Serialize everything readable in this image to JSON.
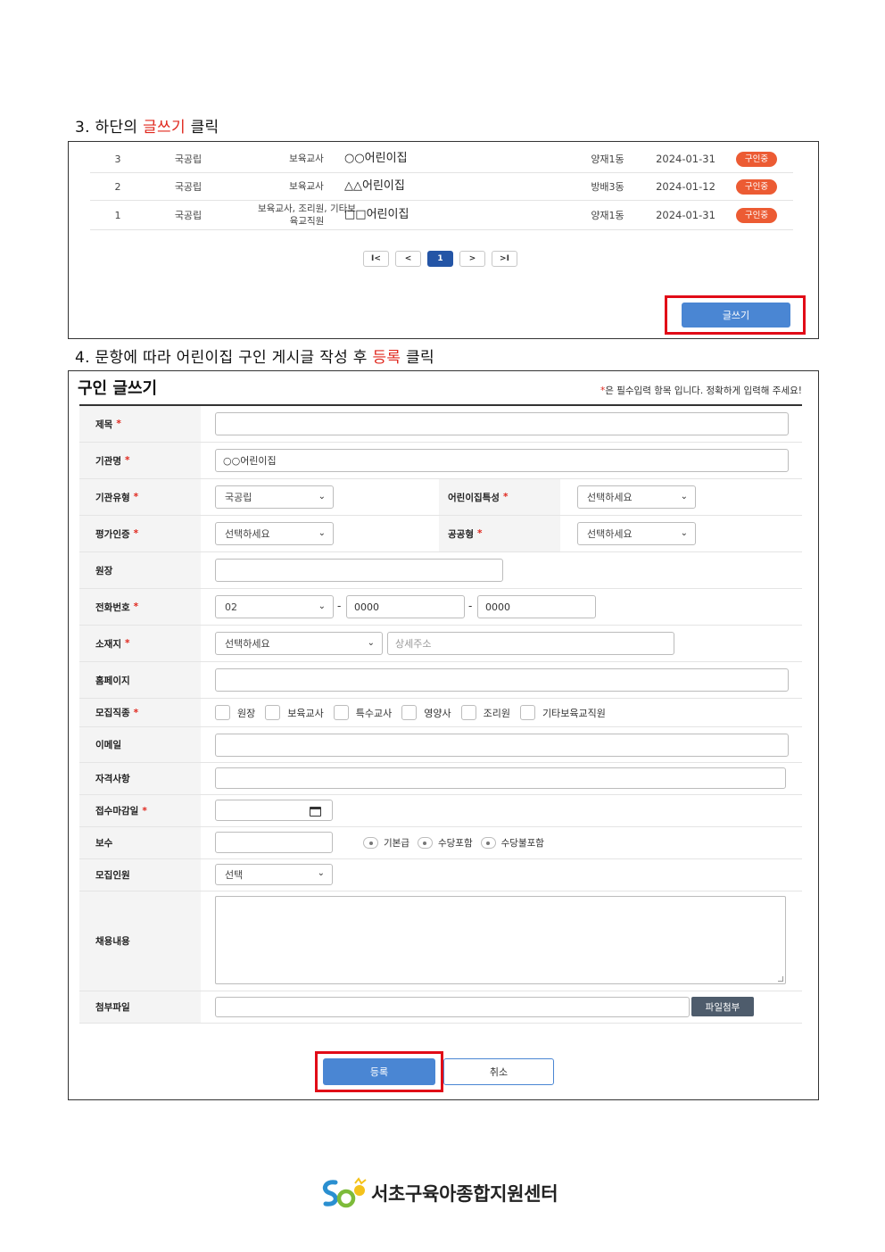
{
  "step3": {
    "prefix": "3. 하단의 ",
    "highlight": "글쓰기",
    "suffix": " 클릭"
  },
  "step4": {
    "prefix": "4. 문항에 따라 어린이집 구인 게시글 작성 후 ",
    "highlight": "등록",
    "suffix": " 클릭"
  },
  "list": {
    "rows": [
      {
        "no": "3",
        "type": "국공립",
        "job": "보육교사",
        "name": "○○어린이집",
        "area": "양재1동",
        "date": "2024-01-31",
        "status": "구인중"
      },
      {
        "no": "2",
        "type": "국공립",
        "job": "보육교사",
        "name": "△△어린이집",
        "area": "방배3동",
        "date": "2024-01-12",
        "status": "구인중"
      },
      {
        "no": "1",
        "type": "국공립",
        "job": "보육교사, 조리원, 기타보육교직원",
        "name": "□□어린이집",
        "area": "양재1동",
        "date": "2024-01-31",
        "status": "구인중"
      }
    ],
    "pager": {
      "first": "I<",
      "prev": "<",
      "current": "1",
      "next": ">",
      "last": ">I"
    },
    "write_label": "글쓰기"
  },
  "form": {
    "title": "구인 글쓰기",
    "required_star": "*",
    "required_note": "은 필수입력 항목 입니다. 정확하게 입력해 주세요!",
    "labels": {
      "subject": "제목",
      "org_name": "기관명",
      "org_type": "기관유형",
      "feature": "어린이집특성",
      "accreditation": "평가인증",
      "public": "공공형",
      "director": "원장",
      "phone": "전화번호",
      "address": "소재지",
      "homepage": "홈페이지",
      "positions": "모집직종",
      "email": "이메일",
      "qualification": "자격사항",
      "deadline": "접수마감일",
      "salary": "보수",
      "headcount": "모집인원",
      "content": "채용내용",
      "attachment": "첨부파일"
    },
    "values": {
      "org_name": "○○어린이집",
      "org_type": "국공립",
      "feature": "선택하세요",
      "accreditation": "선택하세요",
      "public": "선택하세요",
      "phone_area": "02",
      "phone_mid": "0000",
      "phone_last": "0000",
      "address_select": "선택하세요",
      "address_detail_placeholder": "상세주소",
      "headcount": "선택"
    },
    "position_options": [
      "원장",
      "보육교사",
      "특수교사",
      "영양사",
      "조리원",
      "기타보육교직원"
    ],
    "salary_options": [
      "기본급",
      "수당포함",
      "수당불포함"
    ],
    "dash": "-",
    "attach_label": "파일첨부",
    "submit_label": "등록",
    "cancel_label": "취소"
  },
  "footer": {
    "org_name": "서초구육아종합지원센터"
  },
  "colors": {
    "accent_red": "#e0281e",
    "button_blue": "#4a86d3",
    "badge_orange": "#ec5b33",
    "pager_active": "#2455a6"
  }
}
